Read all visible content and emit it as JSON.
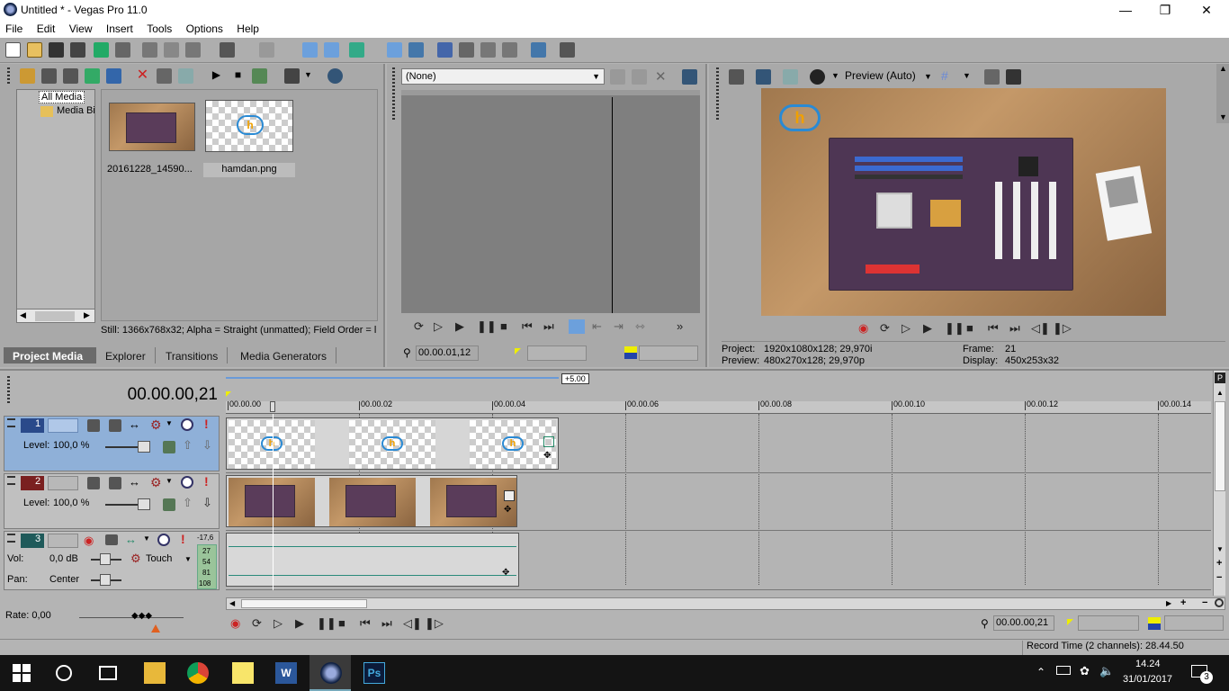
{
  "window": {
    "title": "Untitled * - Vegas Pro 11.0"
  },
  "menu": [
    "File",
    "Edit",
    "View",
    "Insert",
    "Tools",
    "Options",
    "Help"
  ],
  "explorer": {
    "tree": [
      "All Media",
      "Media Bin"
    ],
    "files": [
      {
        "name": "20161228_14590..."
      },
      {
        "name": "hamdan.png"
      }
    ],
    "status": "Still: 1366x768x32; Alpha = Straight (unmatted); Field Order = l"
  },
  "bottom_tabs": [
    "Project Media",
    "Explorer",
    "Transitions",
    "Media Generators"
  ],
  "trimmer": {
    "dropdown": "(None)",
    "timecode": "00.00.01,12"
  },
  "preview": {
    "mode": "Preview (Auto)",
    "project_label": "Project:",
    "project_value": "1920x1080x128; 29,970i",
    "preview_label": "Preview:",
    "preview_value": "480x270x128; 29,970p",
    "frame_label": "Frame:",
    "frame_value": "21",
    "display_label": "Display:",
    "display_value": "450x253x32"
  },
  "timeline": {
    "timecode": "00.00.00,21",
    "zoom_badge": "+5.00",
    "ruler": [
      "00.00.00",
      "00.00.02",
      "00.00.04",
      "00.00.06",
      "00.00.08",
      "00.00.10",
      "00.00.12",
      "00.00.14"
    ],
    "tracks": [
      {
        "num": "1",
        "level_label": "Level:",
        "level_value": "100,0 %"
      },
      {
        "num": "2",
        "level_label": "Level:",
        "level_value": "100,0 %"
      },
      {
        "num": "3",
        "vol_label": "Vol:",
        "vol_value": "0,0 dB",
        "pan_label": "Pan:",
        "pan_value": "Center",
        "mode": "Touch",
        "meter_top": "-17,6",
        "meter_vals": [
          "27",
          "54",
          "81",
          "108"
        ]
      }
    ],
    "rate": "Rate: 0,00",
    "bottom_timecode": "00.00.00,21",
    "record_time": "Record Time (2 channels): 28.44.50"
  },
  "taskbar": {
    "time": "14.24",
    "date": "31/01/2017",
    "notifications": "3"
  },
  "colors": {
    "accent": "#0078d7",
    "track1_sel": "#8fb0d8"
  }
}
